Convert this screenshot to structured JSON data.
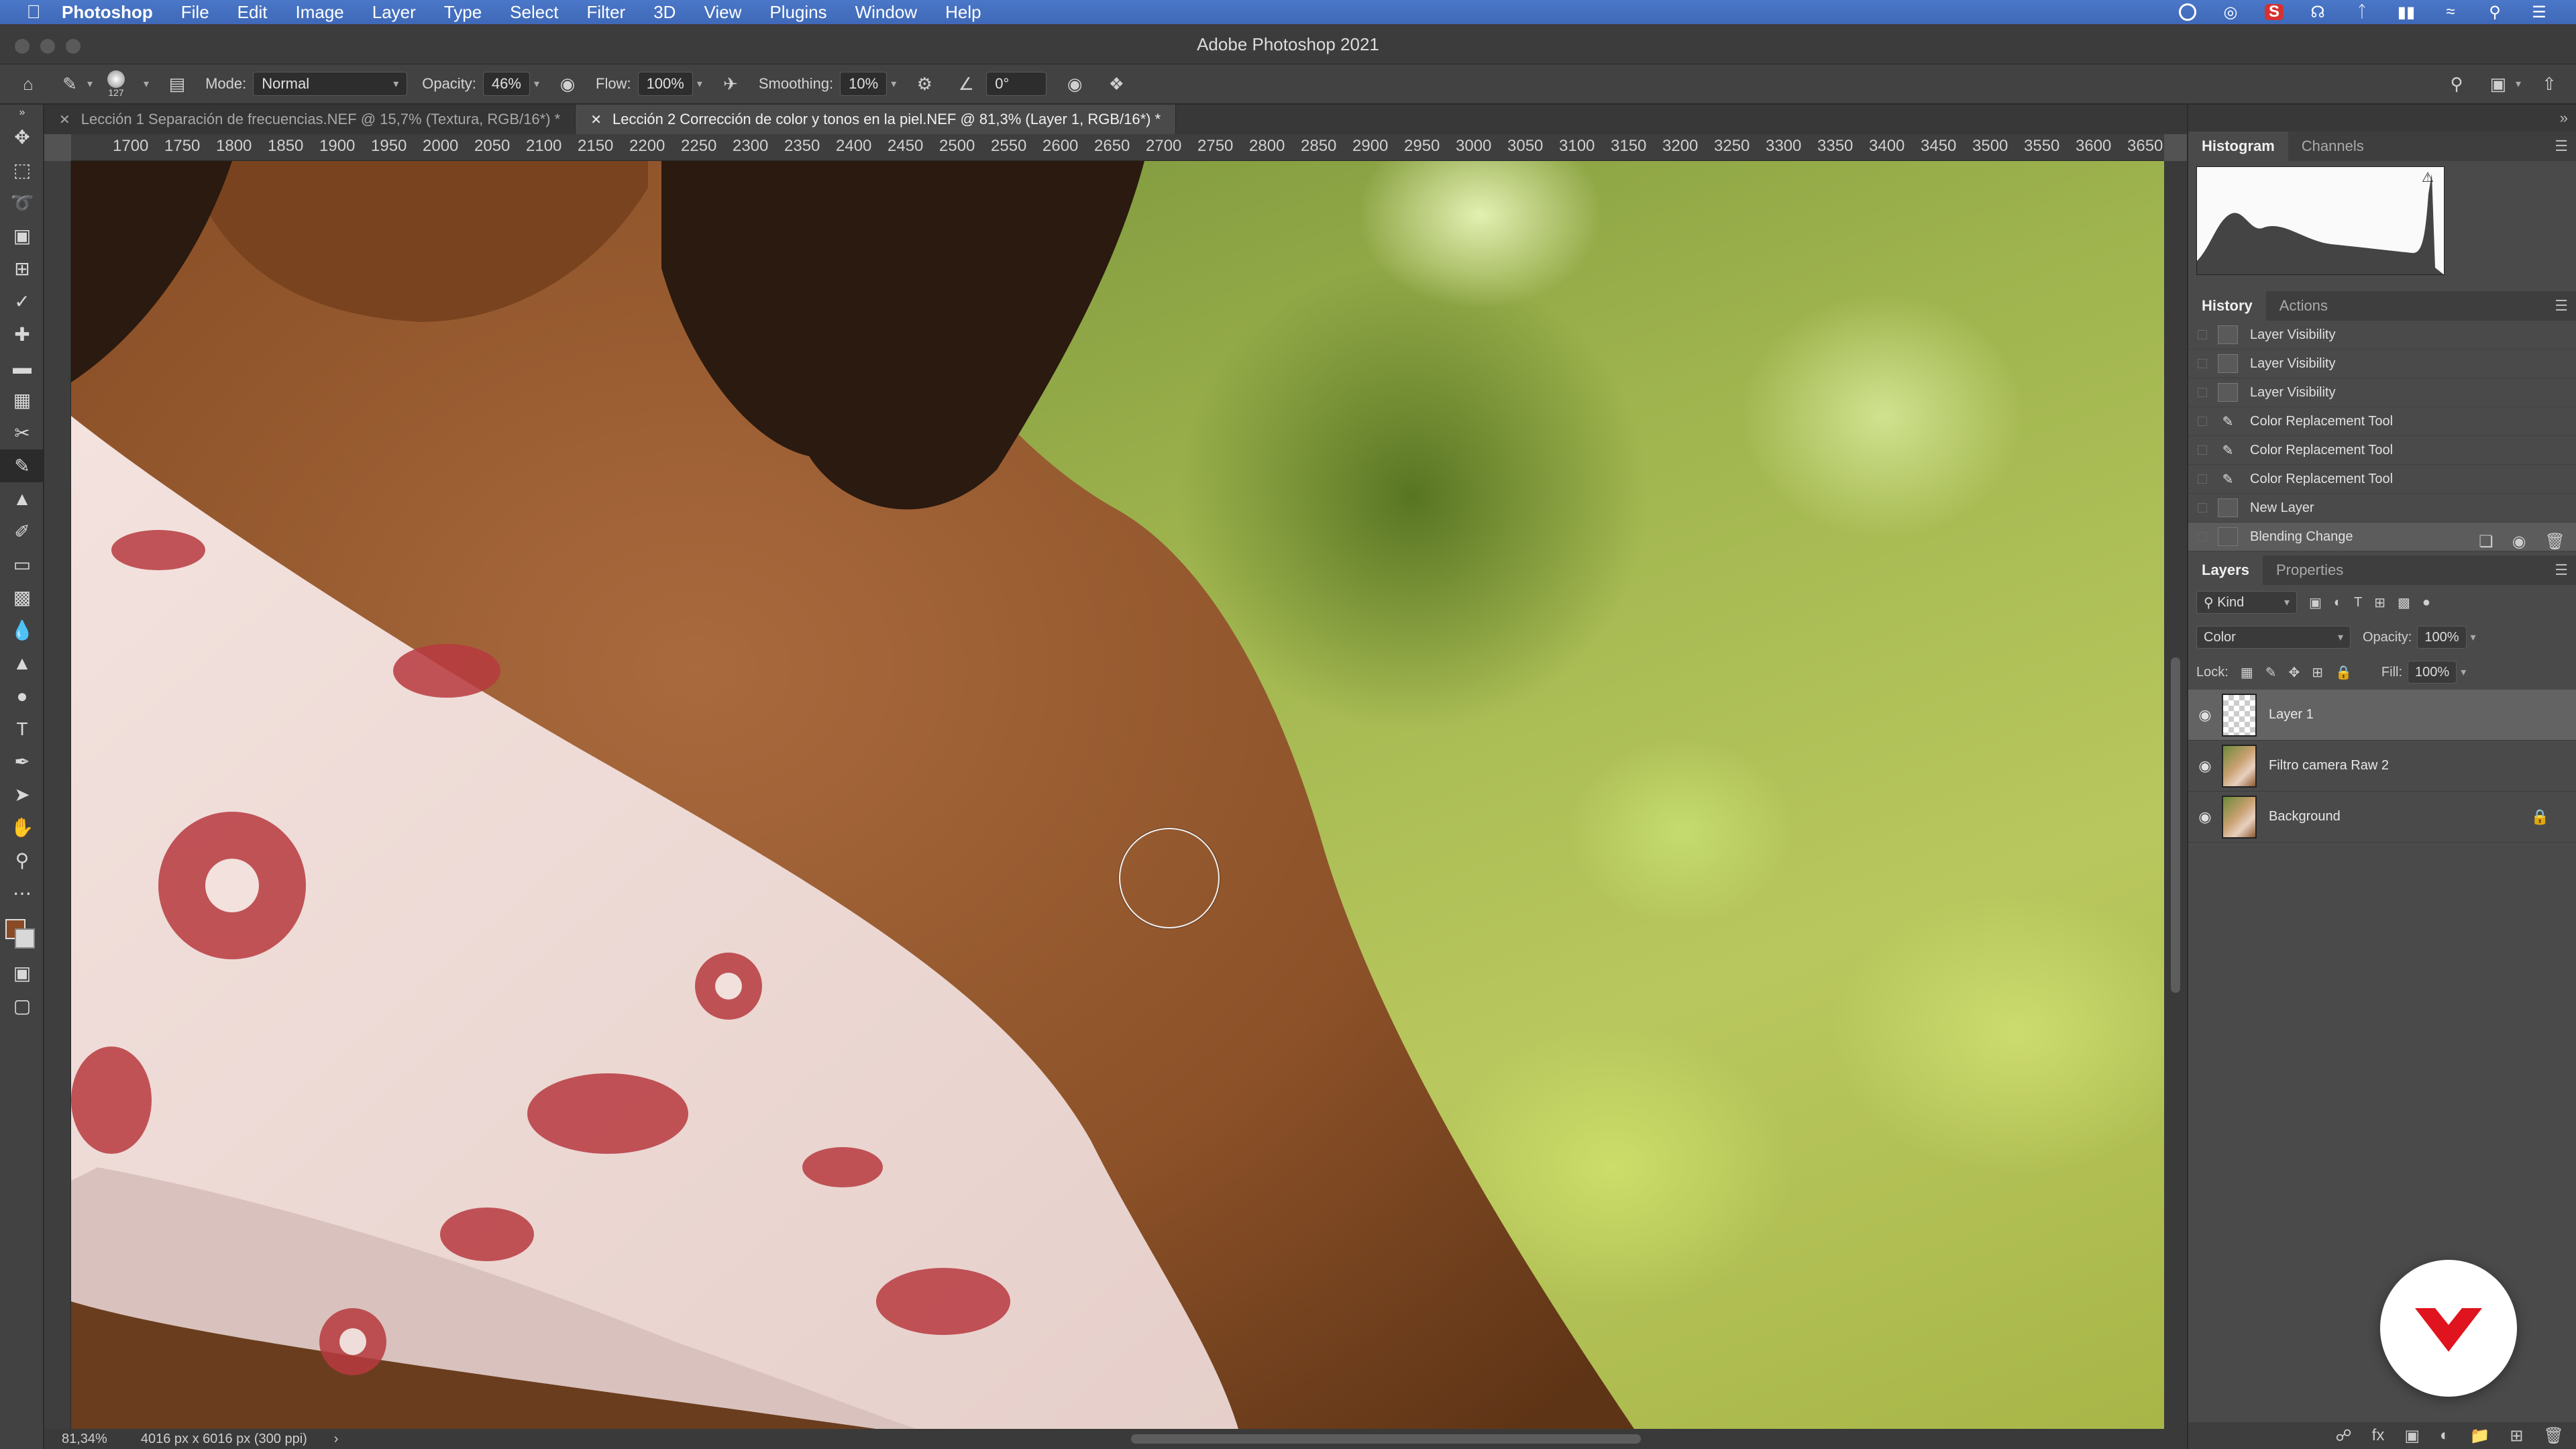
{
  "menubar": {
    "items": [
      "Photoshop",
      "File",
      "Edit",
      "Image",
      "Layer",
      "Type",
      "Select",
      "Filter",
      "3D",
      "View",
      "Plugins",
      "Window",
      "Help"
    ],
    "status_icons": [
      "record-icon",
      "cc-icon",
      "s-icon",
      "headphones-icon",
      "bluetooth-icon",
      "battery-icon",
      "wifi-icon",
      "search-icon",
      "control-center-icon"
    ]
  },
  "window": {
    "title": "Adobe Photoshop 2021"
  },
  "options_bar": {
    "brush_size": "127",
    "mode_label": "Mode:",
    "mode_value": "Normal",
    "opacity_label": "Opacity:",
    "opacity_value": "46%",
    "flow_label": "Flow:",
    "flow_value": "100%",
    "smoothing_label": "Smoothing:",
    "smoothing_value": "10%",
    "angle_value": "0°"
  },
  "tabs": [
    {
      "label": "Lección 1 Separación de frecuencias.NEF @ 15,7% (Textura, RGB/16*) *",
      "active": false
    },
    {
      "label": "Lección 2 Corrección de color y tonos en la piel.NEF @ 81,3% (Layer 1, RGB/16*) *",
      "active": true
    }
  ],
  "ruler": {
    "ticks": [
      "1700",
      "1750",
      "1800",
      "1850",
      "1900",
      "1950",
      "2000",
      "2050",
      "2100",
      "2150",
      "2200",
      "2250",
      "2300",
      "2350",
      "2400",
      "2450",
      "2500",
      "2550",
      "2600",
      "2650",
      "2700",
      "2750",
      "2800",
      "2850",
      "2900",
      "2950",
      "3000",
      "3050",
      "3100",
      "3150",
      "3200",
      "3250",
      "3300",
      "3350",
      "3400",
      "3450",
      "3500",
      "3550",
      "3600",
      "3650"
    ]
  },
  "status": {
    "zoom": "81,34%",
    "doc_size": "4016 px x 6016 px (300 ppi)"
  },
  "histogram_panel": {
    "tabs": [
      "Histogram",
      "Channels"
    ]
  },
  "history_panel": {
    "tabs": [
      "History",
      "Actions"
    ],
    "items": [
      {
        "label": "Layer Visibility",
        "icon": "layer-icon"
      },
      {
        "label": "Layer Visibility",
        "icon": "layer-icon"
      },
      {
        "label": "Layer Visibility",
        "icon": "layer-icon"
      },
      {
        "label": "Color Replacement Tool",
        "icon": "brush-icon"
      },
      {
        "label": "Color Replacement Tool",
        "icon": "brush-icon"
      },
      {
        "label": "Color Replacement Tool",
        "icon": "brush-icon"
      },
      {
        "label": "New Layer",
        "icon": "layer-icon"
      },
      {
        "label": "Blending Change",
        "icon": "layer-icon",
        "selected": true
      }
    ]
  },
  "layers_panel": {
    "tabs": [
      "Layers",
      "Properties"
    ],
    "filter_kind": "Kind",
    "blend_mode": "Color",
    "opacity_label": "Opacity:",
    "opacity_value": "100%",
    "lock_label": "Lock:",
    "fill_label": "Fill:",
    "fill_value": "100%",
    "layers": [
      {
        "name": "Layer 1",
        "selected": true,
        "thumb": "transparent"
      },
      {
        "name": "Filtro camera Raw 2",
        "selected": false,
        "thumb": "photo"
      },
      {
        "name": "Background",
        "selected": false,
        "thumb": "photo",
        "locked": true
      }
    ]
  },
  "colors": {
    "menubar": "#4a75c6",
    "foreground": "#8a4a25",
    "logo_red": "#e0141e"
  }
}
